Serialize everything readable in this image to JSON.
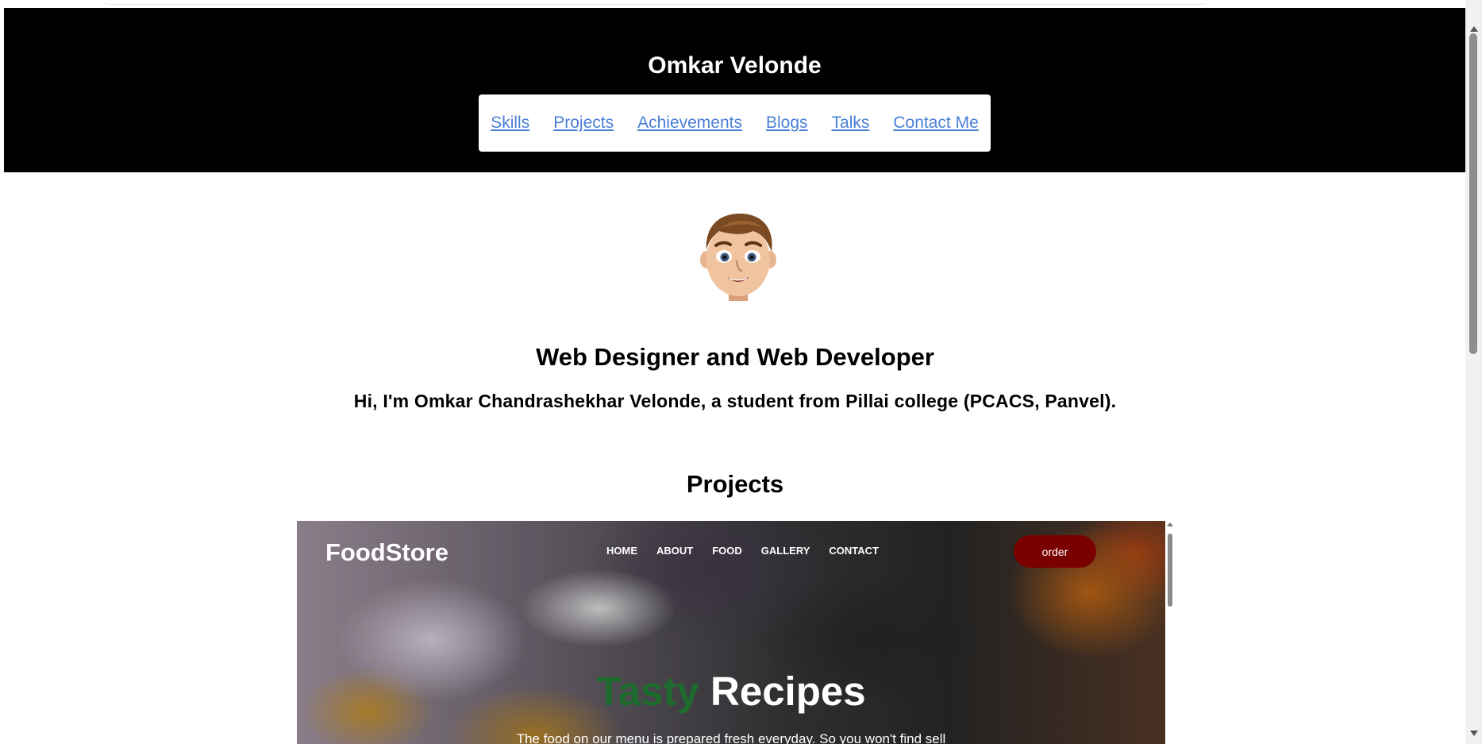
{
  "header": {
    "title": "Omkar Velonde",
    "nav": [
      "Skills",
      "Projects",
      "Achievements",
      "Blogs",
      "Talks",
      "Contact Me"
    ]
  },
  "profile": {
    "avatar_icon": "memoji-avatar-icon",
    "role": "Web Designer and Web Developer",
    "intro": "Hi, I'm Omkar Chandrashekhar Velonde, a student from Pillai college (PCACS, Panvel)."
  },
  "projects": {
    "title": "Projects",
    "preview": {
      "logo": "FoodStore",
      "nav": [
        "HOME",
        "ABOUT",
        "FOOD",
        "GALLERY",
        "CONTACT"
      ],
      "order_label": "order",
      "hero_word1": "Tasty",
      "hero_word2": "Recipes",
      "subtitle": "The food on our menu is prepared fresh everyday. So you won't find sell"
    }
  },
  "colors": {
    "header_bg": "#000000",
    "link": "#4a7fd6",
    "order_button": "#7a0000",
    "hero_green": "#1e6b2e"
  }
}
